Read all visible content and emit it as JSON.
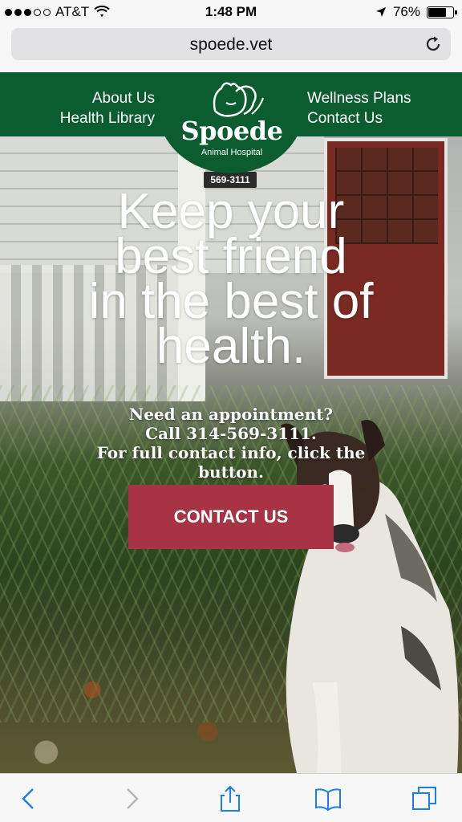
{
  "status_bar": {
    "carrier": "AT&T",
    "time": "1:48 PM",
    "battery": "76%",
    "battery_level": 0.76,
    "signal_icon": "signal-dots-icon",
    "wifi_icon": "wifi-icon",
    "location_icon": "location-arrow-icon"
  },
  "browser": {
    "url": "spoede.vet",
    "reload_icon": "reload-icon"
  },
  "site": {
    "nav_left": [
      "About Us",
      "Health Library"
    ],
    "nav_right": [
      "Wellness Plans",
      "Contact Us"
    ],
    "logo_name": "Spoede",
    "logo_sub": "Animal Hospital",
    "house_number": "569-3111",
    "headline": [
      "Keep your",
      "best friend",
      "in the best of",
      "health."
    ],
    "appointment": [
      "Need an appointment?",
      "Call 314-569-3111.",
      "For full contact info, click the",
      "button."
    ],
    "cta": "CONTACT US",
    "colors": {
      "header_green": "#0b5c2f",
      "cta_red": "#a83345"
    }
  },
  "toolbar": {
    "icons": [
      "back-icon",
      "forward-icon",
      "share-icon",
      "bookmarks-icon",
      "tabs-icon"
    ]
  }
}
